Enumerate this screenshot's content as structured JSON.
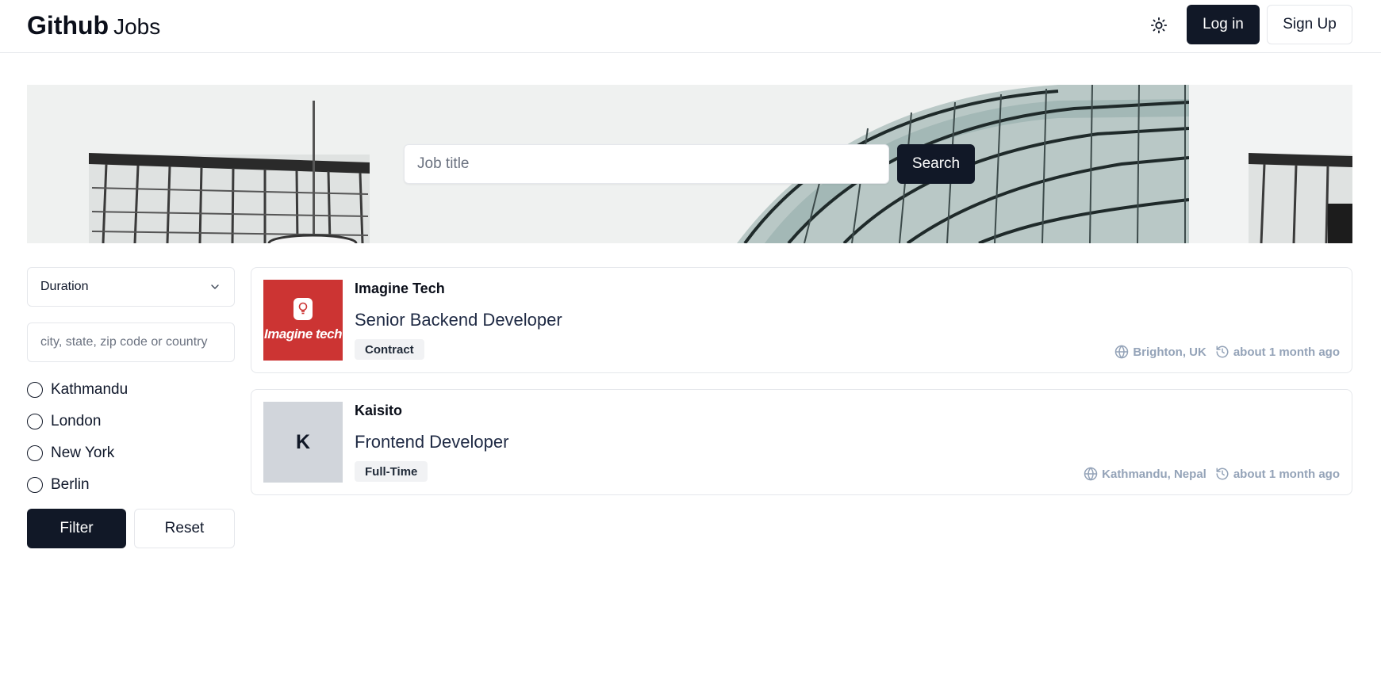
{
  "header": {
    "logo_bold": "Github",
    "logo_light": "Jobs",
    "theme_icon": "sun-icon",
    "login_label": "Log in",
    "signup_label": "Sign Up"
  },
  "hero": {
    "search_placeholder": "Job title",
    "search_value": "",
    "search_button": "Search"
  },
  "sidebar": {
    "duration_select": {
      "selected": "Duration"
    },
    "location_placeholder": "city, state, zip code or country",
    "location_value": "",
    "locations": [
      {
        "label": "Kathmandu"
      },
      {
        "label": "London"
      },
      {
        "label": "New York"
      },
      {
        "label": "Berlin"
      }
    ],
    "filter_label": "Filter",
    "reset_label": "Reset"
  },
  "jobs": [
    {
      "company": "Imagine Tech",
      "logo_text": "Imagine tech",
      "logo_color": "#cc3433",
      "title": "Senior Backend Developer",
      "type": "Contract",
      "location": "Brighton, UK",
      "posted": "about 1 month ago"
    },
    {
      "company": "Kaisito",
      "logo_letter": "K",
      "logo_color": "#d1d5db",
      "title": "Frontend Developer",
      "type": "Full-Time",
      "location": "Kathmandu, Nepal",
      "posted": "about 1 month ago"
    }
  ],
  "colors": {
    "primary": "#111827",
    "muted_text": "#94a3b8",
    "border": "#e5e7eb"
  }
}
